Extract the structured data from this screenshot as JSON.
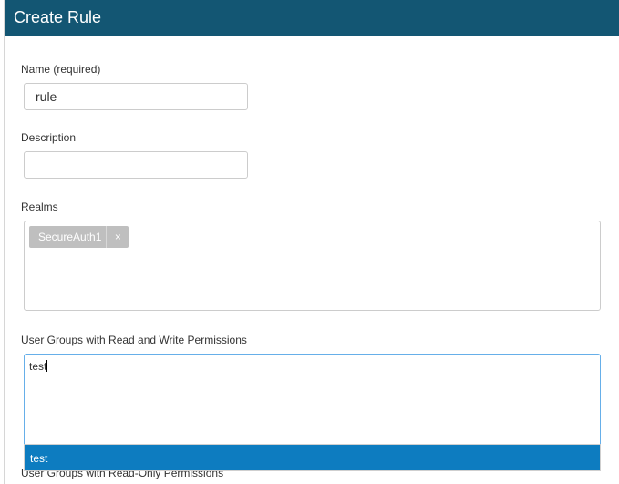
{
  "header": {
    "title": "Create Rule"
  },
  "name_field": {
    "label": "Name (required)",
    "value": "rule"
  },
  "description_field": {
    "label": "Description",
    "value": ""
  },
  "realms_field": {
    "label": "Realms",
    "tags": [
      {
        "label": "SecureAuth1",
        "remove": "×"
      }
    ]
  },
  "read_write_groups": {
    "label": "User Groups with Read and Write Permissions",
    "typed": "test",
    "suggestions": [
      "test"
    ]
  },
  "read_only_groups": {
    "label": "User Groups with Read-Only Permissions"
  },
  "colors": {
    "header": "#135673",
    "highlight": "#0d7cc0",
    "tag": "#bfbfbf",
    "focus_border": "#66afe9"
  }
}
